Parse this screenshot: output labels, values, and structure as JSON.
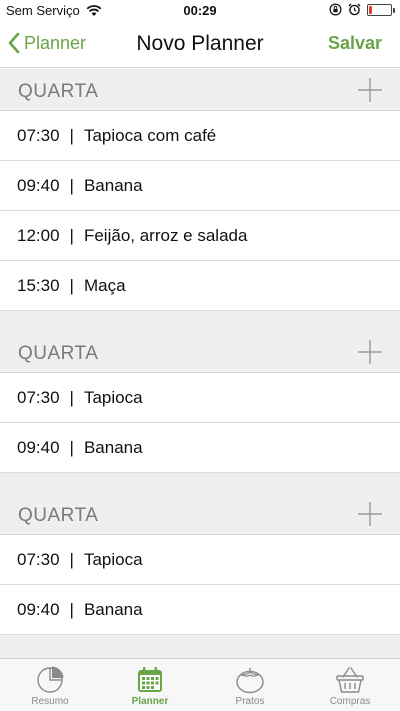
{
  "status_bar": {
    "carrier": "Sem Serviço",
    "time": "00:29"
  },
  "nav": {
    "back_label": "Planner",
    "title": "Novo Planner",
    "save_label": "Salvar"
  },
  "days": [
    {
      "label": "QUARTA",
      "meals": [
        {
          "time": "07:30",
          "separator": "|",
          "food": "Tapioca com café"
        },
        {
          "time": "09:40",
          "separator": "|",
          "food": "Banana"
        },
        {
          "time": "12:00",
          "separator": "|",
          "food": "Feijão, arroz e salada"
        },
        {
          "time": "15:30",
          "separator": "|",
          "food": "Maça"
        }
      ]
    },
    {
      "label": "QUARTA",
      "meals": [
        {
          "time": "07:30",
          "separator": "|",
          "food": "Tapioca"
        },
        {
          "time": "09:40",
          "separator": "|",
          "food": "Banana"
        }
      ]
    },
    {
      "label": "QUARTA",
      "meals": [
        {
          "time": "07:30",
          "separator": "|",
          "food": "Tapioca"
        },
        {
          "time": "09:40",
          "separator": "|",
          "food": "Banana"
        }
      ]
    }
  ],
  "tabs": [
    {
      "label": "Resumo",
      "icon": "pie-chart-icon",
      "active": false
    },
    {
      "label": "Planner",
      "icon": "calendar-icon",
      "active": true
    },
    {
      "label": "Pratos",
      "icon": "tomato-icon",
      "active": false
    },
    {
      "label": "Compras",
      "icon": "basket-icon",
      "active": false
    }
  ],
  "colors": {
    "accent": "#6aa449",
    "section_bg": "#efefef",
    "battery_low": "#e23b2e"
  }
}
